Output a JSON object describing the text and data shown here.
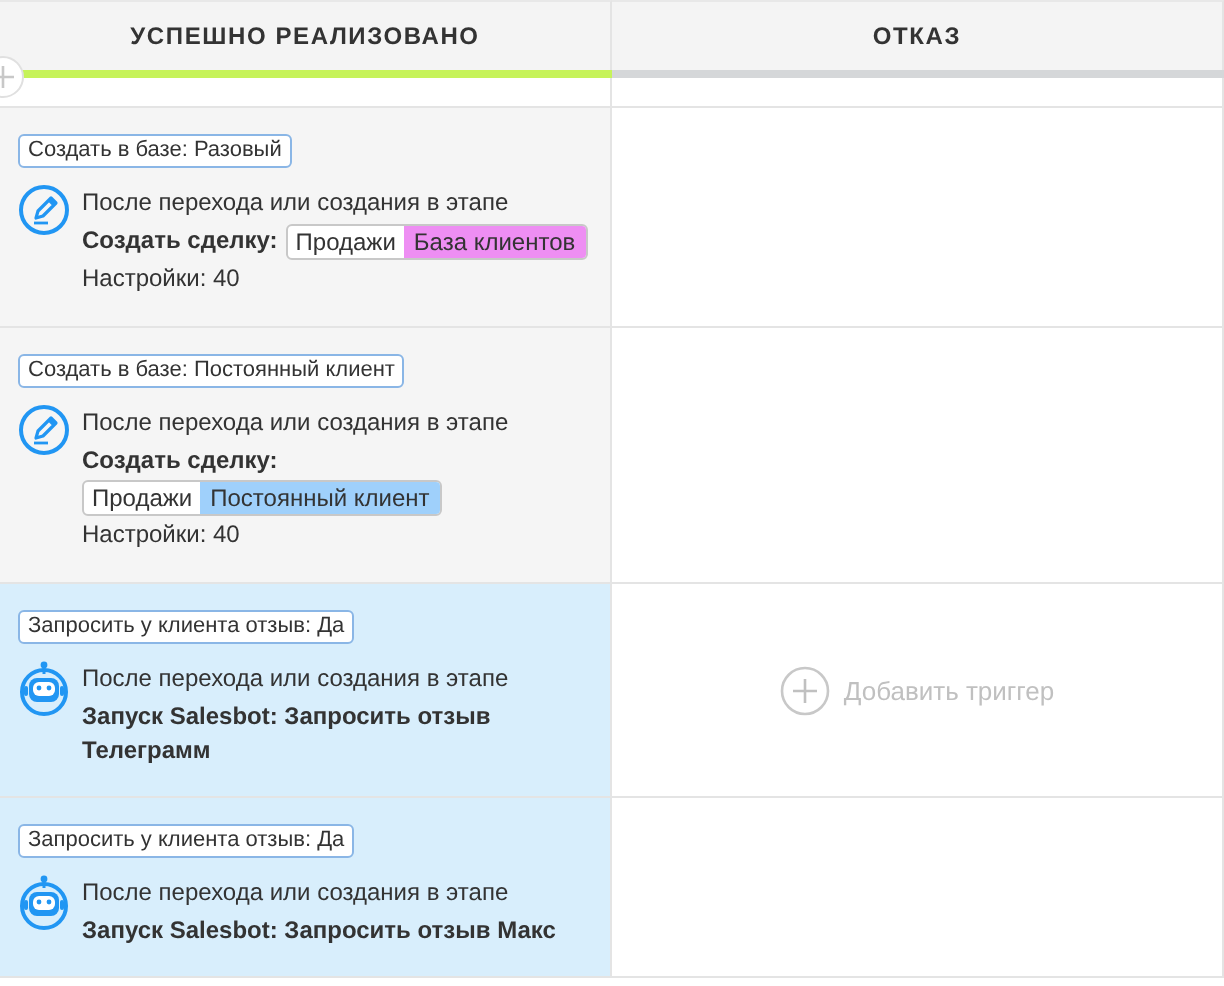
{
  "columns": [
    {
      "title": "УСПЕШНО РЕАЛИЗОВАНО",
      "color": "#c6f35a"
    },
    {
      "title": "ОТКАЗ",
      "color": "#d5d7d9"
    }
  ],
  "triggers": [
    {
      "kind": "deal",
      "condition": "Создать в базе: Разовый",
      "event": "После перехода или создания в этапе",
      "action": "Создать сделку:",
      "pipeline": "Продажи",
      "stage": "База клиентов",
      "color": "#ee8ef3",
      "settings": "Настройки: 40"
    },
    {
      "kind": "deal",
      "condition": "Создать в базе: Постоянный клиент",
      "event": "После перехода или создания в этапе",
      "action": "Создать сделку:",
      "pipeline": "Продажи",
      "stage": "Постоянный клиент",
      "color": "#9fd0fb",
      "settings": "Настройки: 40"
    },
    {
      "kind": "salesbot",
      "condition": "Запросить у клиента отзыв: Да",
      "event": "После перехода или создания в этапе",
      "action": "Запуск Salesbot: Запросить отзыв Телеграмм"
    },
    {
      "kind": "salesbot",
      "condition": "Запросить у клиента отзыв: Да",
      "event": "После перехода или создания в этапе",
      "action": "Запуск Salesbot: Запросить отзыв Макс"
    }
  ],
  "add_trigger": {
    "label": "Добавить триггер"
  }
}
